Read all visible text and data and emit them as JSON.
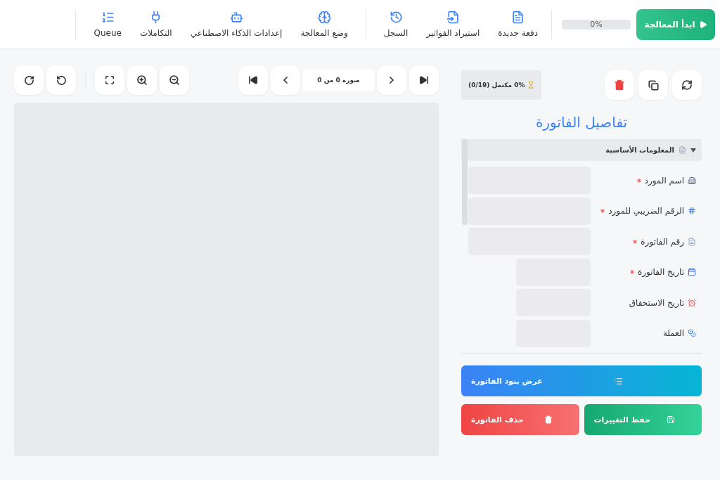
{
  "header": {
    "start_button": "ابدأ المعالجة",
    "progress": {
      "level": 0,
      "reading": "0%"
    },
    "nav_groups": [
      [
        {
          "label": "دفعة جديدة"
        },
        {
          "label": "استيراد الفواتير"
        },
        {
          "label": "السجل"
        }
      ],
      [
        {
          "label": "وضع المعالجة"
        },
        {
          "label": "إعدادات الذكاء الاصطناعي"
        },
        {
          "label": "التكاملات"
        },
        {
          "label": "Queue"
        }
      ]
    ]
  },
  "details": {
    "status": "0% مكتمل (0/19)",
    "title": "تفاصيل الفاتورة",
    "section": {
      "title": "المعلومات الأساسية",
      "expanded": true,
      "fields": [
        {
          "label": "اسم المورد",
          "required": true,
          "kind": "text"
        },
        {
          "label": "الرقم الضريبي للمورد",
          "required": true,
          "kind": "text"
        },
        {
          "label": "رقم الفاتورة",
          "required": true,
          "kind": "text"
        },
        {
          "label": "تاريخ الفاتورة",
          "required": true,
          "kind": "date"
        },
        {
          "label": "تاريخ الاستحقاق",
          "required": false,
          "kind": "date"
        },
        {
          "label": "العملة",
          "required": false,
          "kind": "select"
        }
      ]
    },
    "items_button": "عرض بنود الفاتورة",
    "save_button": "حفظ التغييرات",
    "delete_button": "حذف الفاتورة"
  },
  "viewer": {
    "counter": "صورة 0 من 0"
  }
}
